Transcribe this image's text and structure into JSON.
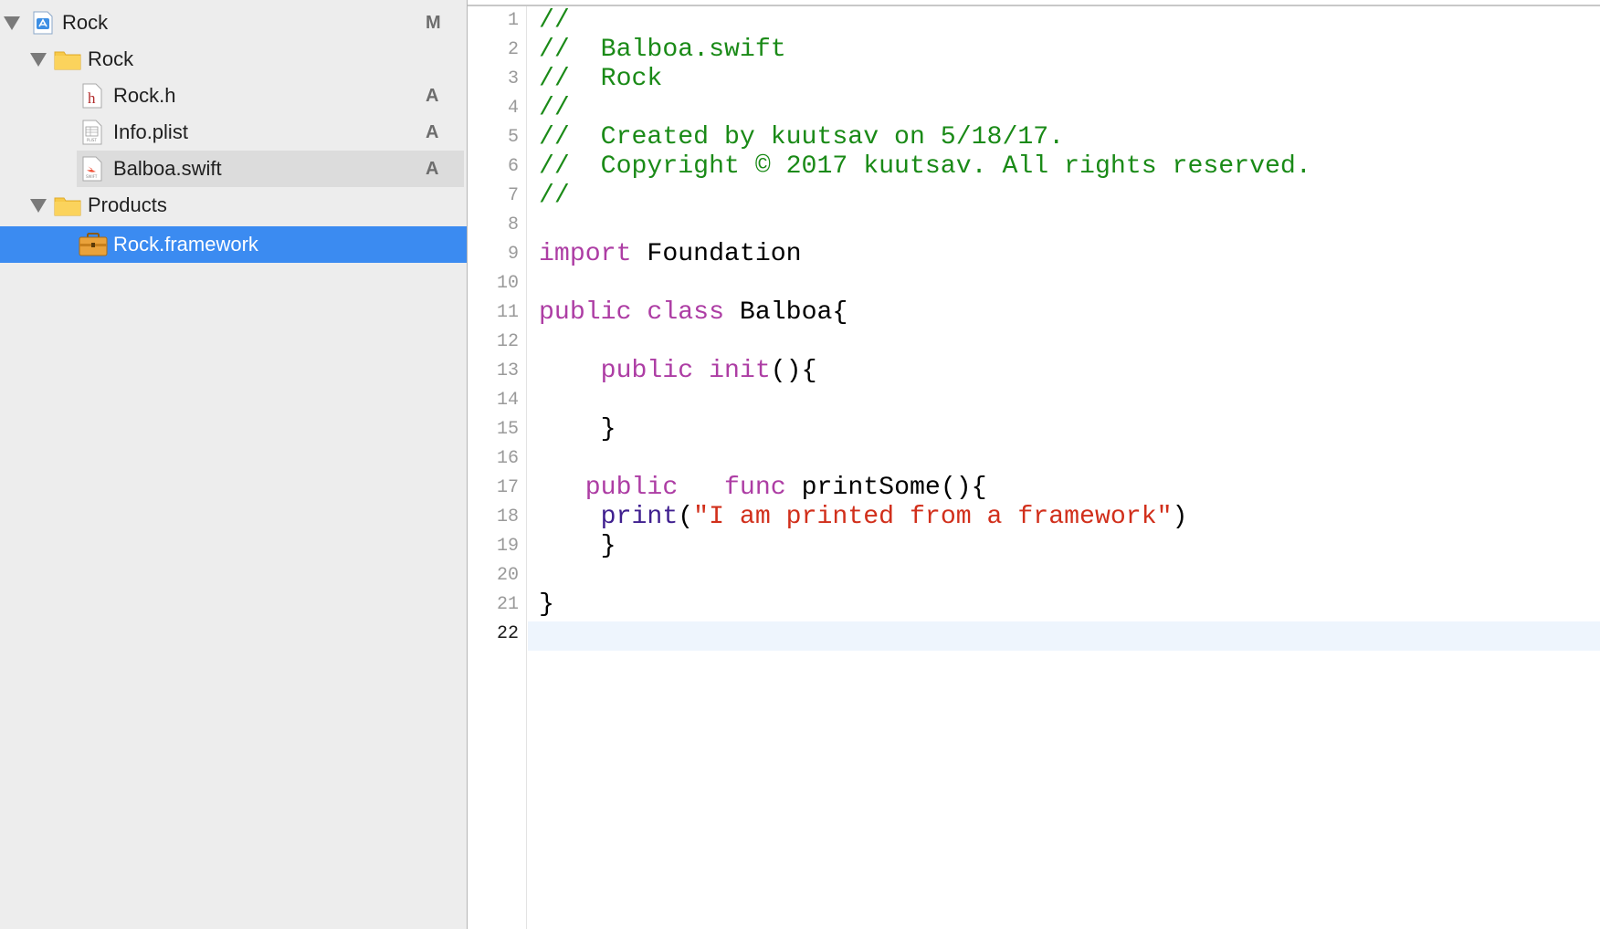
{
  "navigator": {
    "items": [
      {
        "label": "Rock",
        "icon": "xcode-project-icon",
        "badge": "M"
      },
      {
        "label": "Rock",
        "icon": "folder-icon",
        "badge": ""
      },
      {
        "label": "Rock.h",
        "icon": "header-file-icon",
        "icon_text": "h",
        "badge": "A"
      },
      {
        "label": "Info.plist",
        "icon": "plist-file-icon",
        "icon_text": "PLIST",
        "badge": "A"
      },
      {
        "label": "Balboa.swift",
        "icon": "swift-file-icon",
        "icon_text": "SWIFT",
        "badge": "A"
      },
      {
        "label": "Products",
        "icon": "folder-icon",
        "badge": ""
      },
      {
        "label": "Rock.framework",
        "icon": "framework-icon",
        "badge": ""
      }
    ],
    "colors": {
      "selection": "#3b8bf1",
      "folder": "#f7c948"
    }
  },
  "editor": {
    "current_line": 22,
    "line_numbers": [
      "1",
      "2",
      "3",
      "4",
      "5",
      "6",
      "7",
      "8",
      "9",
      "10",
      "11",
      "12",
      "13",
      "14",
      "15",
      "16",
      "17",
      "18",
      "19",
      "20",
      "21",
      "22"
    ],
    "lines": [
      [
        {
          "t": "//",
          "k": "comment"
        }
      ],
      [
        {
          "t": "//  Balboa.swift",
          "k": "comment"
        }
      ],
      [
        {
          "t": "//  Rock",
          "k": "comment"
        }
      ],
      [
        {
          "t": "//",
          "k": "comment"
        }
      ],
      [
        {
          "t": "//  Created by kuutsav on 5/18/17.",
          "k": "comment"
        }
      ],
      [
        {
          "t": "//  Copyright © 2017 kuutsav. All rights reserved.",
          "k": "comment"
        }
      ],
      [
        {
          "t": "//",
          "k": "comment"
        }
      ],
      [],
      [
        {
          "t": "import",
          "k": "keyword"
        },
        {
          "t": " Foundation",
          "k": "plain"
        }
      ],
      [],
      [
        {
          "t": "public",
          "k": "keyword"
        },
        {
          "t": " ",
          "k": "plain"
        },
        {
          "t": "class",
          "k": "keyword"
        },
        {
          "t": " Balboa{",
          "k": "plain"
        }
      ],
      [],
      [
        {
          "t": "    ",
          "k": "plain"
        },
        {
          "t": "public",
          "k": "keyword"
        },
        {
          "t": " ",
          "k": "plain"
        },
        {
          "t": "init",
          "k": "keyword"
        },
        {
          "t": "(){",
          "k": "plain"
        }
      ],
      [],
      [
        {
          "t": "    }",
          "k": "plain"
        }
      ],
      [],
      [
        {
          "t": "   ",
          "k": "plain"
        },
        {
          "t": "public",
          "k": "keyword"
        },
        {
          "t": "   ",
          "k": "plain"
        },
        {
          "t": "func",
          "k": "keyword"
        },
        {
          "t": " printSome(){",
          "k": "plain"
        }
      ],
      [
        {
          "t": "    ",
          "k": "plain"
        },
        {
          "t": "print",
          "k": "func"
        },
        {
          "t": "(",
          "k": "plain"
        },
        {
          "t": "\"I am printed from a framework\"",
          "k": "string"
        },
        {
          "t": ")",
          "k": "plain"
        }
      ],
      [
        {
          "t": "    }",
          "k": "plain"
        }
      ],
      [],
      [
        {
          "t": "}",
          "k": "plain"
        }
      ],
      []
    ],
    "colors": {
      "comment": "#1a8a17",
      "keyword": "#ad3da4",
      "string": "#d12f1b",
      "func": "#3f1f8f",
      "current_line": "#eef5fd"
    }
  }
}
